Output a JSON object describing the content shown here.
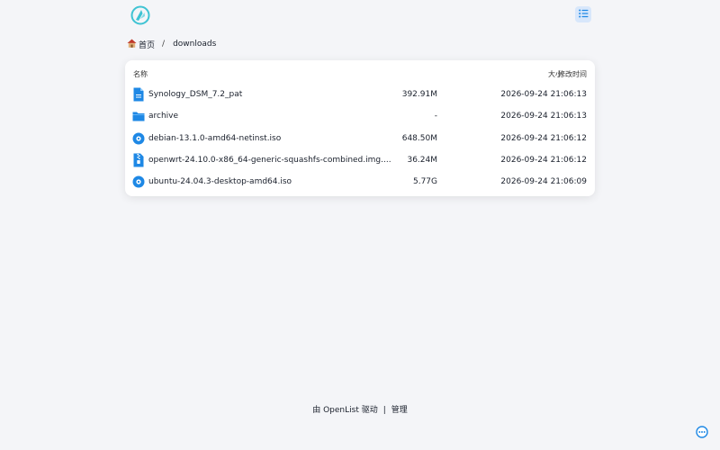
{
  "header": {
    "logo_icon": "openlist-logo-icon",
    "layout_icon": "list-layout-icon"
  },
  "breadcrumb": {
    "home_icon": "house-emoji-icon",
    "home_label": "首页",
    "separator": "/",
    "current": "downloads"
  },
  "table": {
    "columns": {
      "name": "名称",
      "size": "大小",
      "modified": "修改时间"
    },
    "rows": [
      {
        "icon": "file-icon",
        "name": "Synology_DSM_7.2_pat",
        "size": "392.91M",
        "modified": "2026-09-24 21:06:13"
      },
      {
        "icon": "folder-icon",
        "name": "archive",
        "size": "-",
        "modified": "2026-09-24 21:06:13"
      },
      {
        "icon": "disc-icon",
        "name": "debian-13.1.0-amd64-netinst.iso",
        "size": "648.50M",
        "modified": "2026-09-24 21:06:12"
      },
      {
        "icon": "archive-file-icon",
        "name": "openwrt-24.10.0-x86_64-generic-squashfs-combined.img....",
        "size": "36.24M",
        "modified": "2026-09-24 21:06:12"
      },
      {
        "icon": "disc-icon",
        "name": "ubuntu-24.04.3-desktop-amd64.iso",
        "size": "5.77G",
        "modified": "2026-09-24 21:06:09"
      }
    ]
  },
  "footer": {
    "powered_by": "由 OpenList 驱动",
    "separator": "|",
    "manage": "管理"
  },
  "floating": {
    "icon": "more-dots-icon"
  },
  "colors": {
    "accent": "#1e88e5",
    "background": "#f4f5f8",
    "layout_btn_bg": "#d8e7fb",
    "logo_teal": "#3ec3d3"
  }
}
